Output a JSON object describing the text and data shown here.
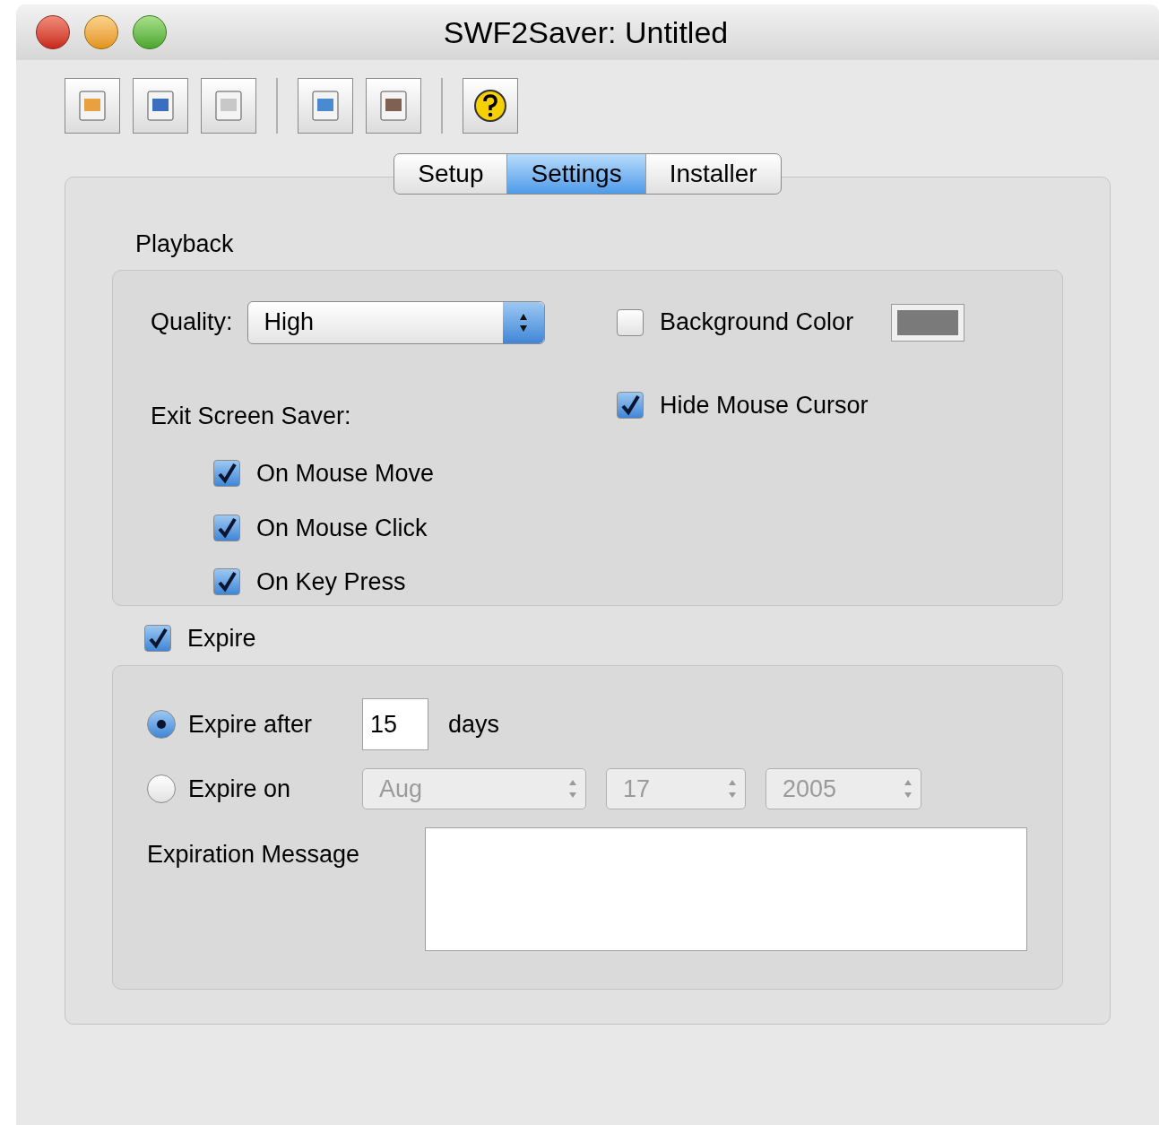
{
  "window": {
    "title": "SWF2Saver: Untitled"
  },
  "tabs": [
    {
      "label": "Setup",
      "selected": false
    },
    {
      "label": "Settings",
      "selected": true
    },
    {
      "label": "Installer",
      "selected": false
    }
  ],
  "playback": {
    "title": "Playback",
    "quality": {
      "label": "Quality:",
      "value": "High"
    },
    "background_color": {
      "label": "Background Color",
      "checked": false,
      "color": "#7a7a7a"
    },
    "hide_mouse_cursor": {
      "label": "Hide Mouse Cursor",
      "checked": true
    },
    "exit_label": "Exit Screen Saver:",
    "exit_options": [
      {
        "label": "On Mouse Move",
        "checked": true
      },
      {
        "label": "On Mouse Click",
        "checked": true
      },
      {
        "label": "On Key Press",
        "checked": true
      }
    ]
  },
  "expire": {
    "label": "Expire",
    "checked": true,
    "after": {
      "label": "Expire after",
      "selected": true,
      "value": "15",
      "unit": "days"
    },
    "on": {
      "label": "Expire on",
      "selected": false,
      "disabled": true,
      "month": "Aug",
      "day": "17",
      "year": "2005"
    },
    "message_label": "Expiration Message"
  }
}
